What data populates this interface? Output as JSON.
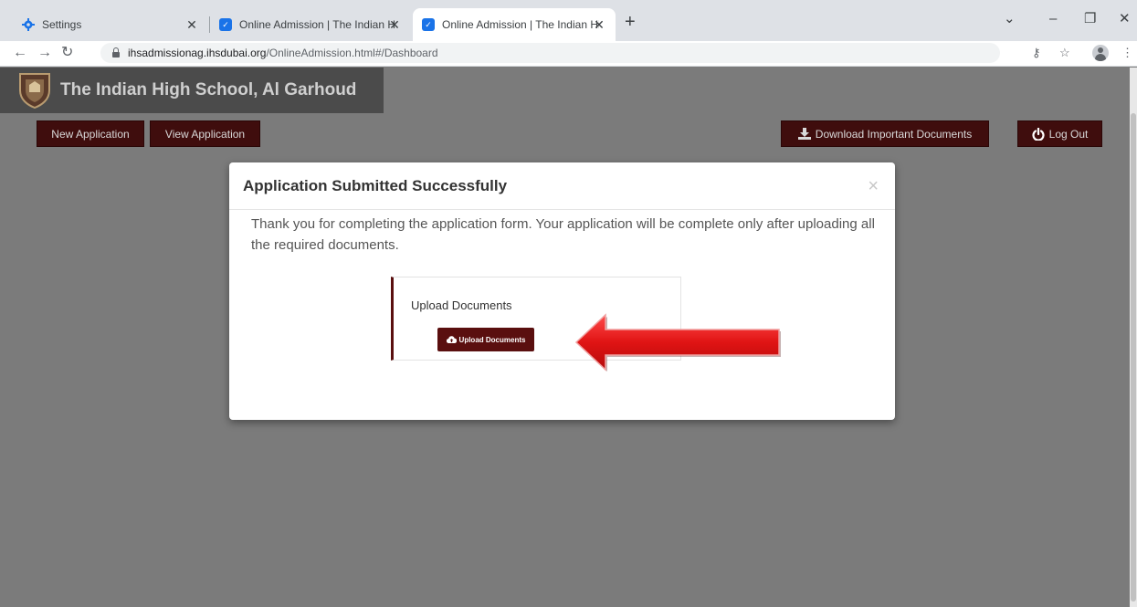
{
  "browser": {
    "tabs": [
      {
        "title": "Settings",
        "icon": "gear-icon"
      },
      {
        "title": "Online Admission | The Indian Hi",
        "icon": "school-favicon"
      },
      {
        "title": "Online Admission | The Indian Hi",
        "icon": "school-favicon",
        "active": true
      }
    ],
    "url_host": "ihsadmissionag.ihsdubai.org",
    "url_path": "/OnlineAdmission.html#/Dashboard"
  },
  "header": {
    "school_name": "The Indian High School, Al Garhoud"
  },
  "nav": {
    "new_application": "New Application",
    "view_application": "View Application",
    "download_documents": "Download Important Documents",
    "log_out": "Log Out"
  },
  "modal": {
    "title": "Application Submitted Successfully",
    "close": "×",
    "message": "Thank you for completing the application form. Your application will be complete only after uploading all the required documents.",
    "card_title": "Upload Documents",
    "upload_button": "Upload Documents"
  },
  "colors": {
    "maroon": "#3f0d0d",
    "upload_button": "#5a0f0f",
    "overlay": "#7b7b7b",
    "arrow": "#e21b1b"
  }
}
